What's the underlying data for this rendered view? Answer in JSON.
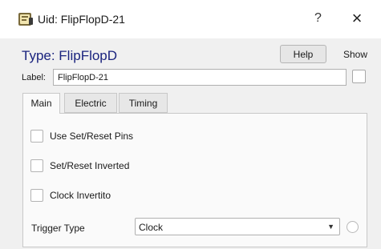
{
  "window": {
    "title": "Uid: FlipFlopD-21",
    "help_glyph": "?",
    "close_glyph": "×",
    "icon": "component-icon"
  },
  "header": {
    "type_title": "Type: FlipFlopD",
    "help_button": "Help",
    "show_label": "Show"
  },
  "label_field": {
    "label": "Label:",
    "value": "FlipFlopD-21",
    "show_checked": false
  },
  "tabs": [
    {
      "label": "Main",
      "active": true
    },
    {
      "label": "Electric",
      "active": false
    },
    {
      "label": "Timing",
      "active": false
    }
  ],
  "options": [
    {
      "label": "Use Set/Reset Pins",
      "checked": false
    },
    {
      "label": "Set/Reset Inverted",
      "checked": false
    },
    {
      "label": "Clock Invertito",
      "checked": false
    }
  ],
  "trigger": {
    "label": "Trigger Type",
    "value": "Clock"
  }
}
